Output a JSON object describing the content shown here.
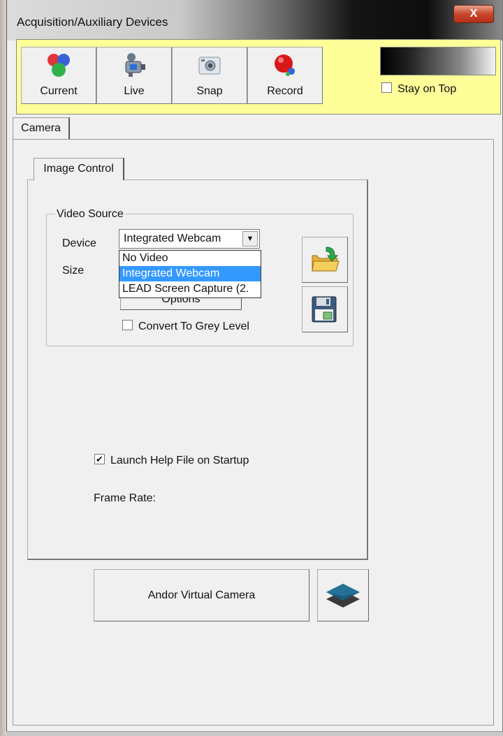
{
  "window": {
    "title": "Acquisition/Auxiliary Devices",
    "close_glyph": "X"
  },
  "toolbar": {
    "buttons": [
      {
        "label": "Current",
        "icon": "rgb-circles-icon"
      },
      {
        "label": "Live",
        "icon": "video-camera-icon"
      },
      {
        "label": "Snap",
        "icon": "photo-camera-icon"
      },
      {
        "label": "Record",
        "icon": "record-icon"
      }
    ],
    "stay_on_top_label": "Stay on Top",
    "stay_on_top_checked": false,
    "background_color": "#ffff99"
  },
  "tabs": {
    "camera": "Camera",
    "image_control": "Image Control"
  },
  "video_source": {
    "legend": "Video Source",
    "device_label": "Device",
    "size_label": "Size",
    "device_value": "Integrated Webcam",
    "device_options": [
      "No Video",
      "Integrated Webcam",
      "LEAD Screen Capture (2."
    ],
    "selected_option": "Integrated Webcam",
    "options_button": "Options",
    "grey_level_label": "Convert To Grey Level",
    "grey_level_checked": false,
    "side_buttons": [
      "open-folder-icon",
      "save-disk-icon"
    ]
  },
  "launch_help": {
    "label": "Launch Help File on Startup",
    "checked": true
  },
  "frame_rate_label": "Frame Rate:",
  "andor_button": "Andor Virtual Camera",
  "layers_icon": "layers-icon",
  "colors": {
    "selection": "#3399ff",
    "close_button": "#c8472c"
  }
}
